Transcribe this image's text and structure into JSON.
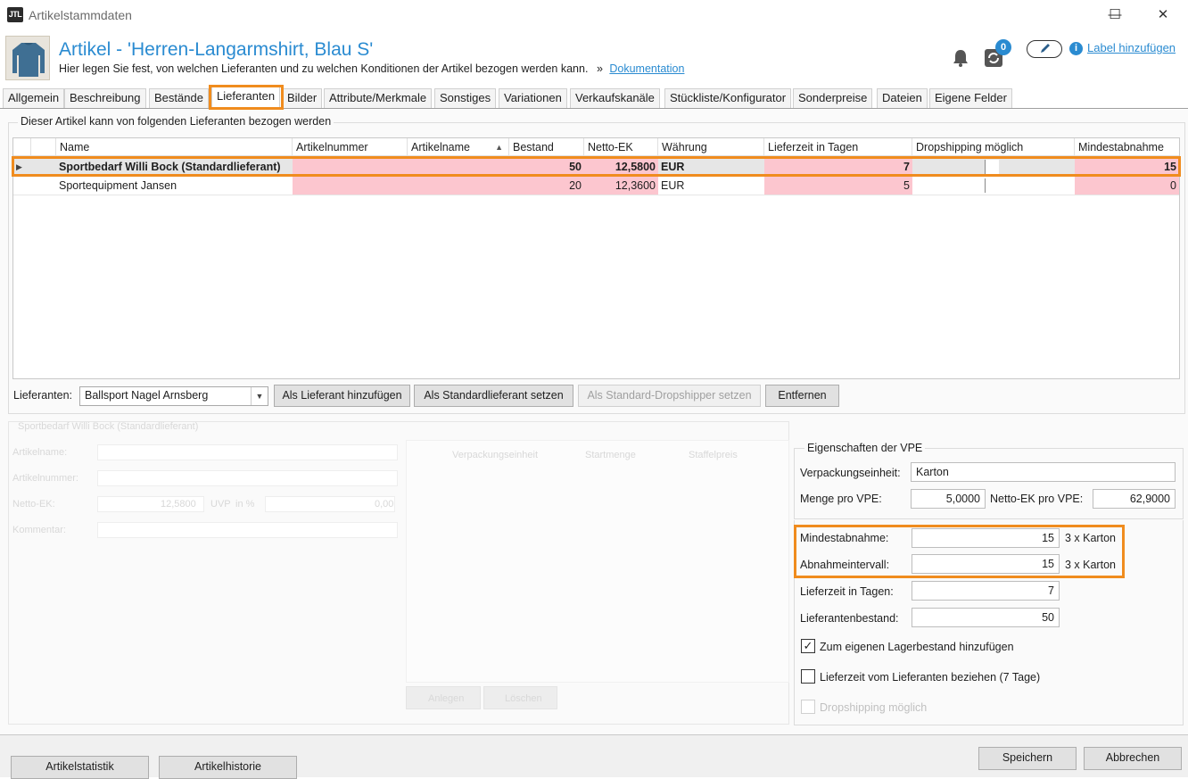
{
  "window": {
    "title": "Artikelstammdaten",
    "minimize": "—",
    "maximize": "☐",
    "close": "✕",
    "logo": "JTL"
  },
  "header": {
    "title": "Artikel - 'Herren-Langarmshirt, Blau S'",
    "description": "Hier legen Sie fest, von welchen Lieferanten und zu welchen Konditionen der Artikel bezogen werden kann.",
    "sep": "»",
    "doc_link": "Dokumentation",
    "sync_count": "0",
    "label_link": "Label hinzufügen"
  },
  "tabs": [
    {
      "label": "Allgemein"
    },
    {
      "label": "Beschreibung"
    },
    {
      "label": "Bestände"
    },
    {
      "label": "Lieferanten"
    },
    {
      "label": "Bilder"
    },
    {
      "label": "Attribute/Merkmale"
    },
    {
      "label": "Sonstiges"
    },
    {
      "label": "Variationen"
    },
    {
      "label": "Verkaufskanäle"
    },
    {
      "label": "Stückliste/Konfigurator"
    },
    {
      "label": "Sonderpreise"
    },
    {
      "label": "Dateien"
    },
    {
      "label": "Eigene Felder"
    }
  ],
  "suppliers_group": {
    "title": "Dieser Artikel kann von folgenden Lieferanten bezogen werden",
    "columns": [
      "Name",
      "Artikelnummer",
      "Artikelname",
      "Bestand",
      "Netto-EK",
      "Währung",
      "Lieferzeit in Tagen",
      "Dropshipping möglich",
      "Mindestabnahme"
    ],
    "rows": [
      {
        "name": "Sportbedarf Willi Bock (Standardlieferant)",
        "artnr": "",
        "artname": "",
        "bestand": "50",
        "netto": "12,5800",
        "waehrung": "EUR",
        "lieferzeit": "7",
        "mindest": "15"
      },
      {
        "name": "Sportequipment Jansen",
        "artnr": "",
        "artname": "",
        "bestand": "20",
        "netto": "12,3600",
        "waehrung": "EUR",
        "lieferzeit": "5",
        "mindest": "0"
      }
    ],
    "supplier_label": "Lieferanten:",
    "supplier_selected": "Ballsport Nagel Arnsberg",
    "btn_add": "Als Lieferant hinzufügen",
    "btn_standard": "Als Standardlieferant setzen",
    "btn_dropshipper": "Als Standard-Dropshipper setzen",
    "btn_remove": "Entfernen"
  },
  "detail_ghost": {
    "title": "Sportbedarf Willi Bock (Standardlieferant)",
    "labels": [
      "Artikelname:",
      "Artikelnummer:",
      "Netto-EK:",
      "Kommentar:"
    ],
    "netto_value": "12,5800",
    "uvp_label": "UVP",
    "uvp_pct": "in %",
    "uvp_value": "0,00",
    "grid_cols": [
      "Verpackungseinheit",
      "Startmenge",
      "Staffelpreis"
    ],
    "btn_add": "Anlegen",
    "btn_del": "Löschen"
  },
  "vpe": {
    "title": "Eigenschaften der VPE",
    "unit_label": "Verpackungseinheit:",
    "unit_value": "Karton",
    "qty_label": "Menge pro VPE:",
    "qty_value": "5,0000",
    "netto_label": "Netto-EK pro VPE:",
    "netto_value": "62,9000",
    "min_label": "Mindestabnahme:",
    "min_value": "15",
    "min_unit": "3 x Karton",
    "interval_label": "Abnahmeintervall:",
    "interval_value": "15",
    "interval_unit": "3 x Karton",
    "leadtime_label": "Lieferzeit in Tagen:",
    "leadtime_value": "7",
    "stock_label": "Lieferantenbestand:",
    "stock_value": "50",
    "chk_own_stock": "Zum eigenen Lagerbestand hinzufügen",
    "chk_leadtime": "Lieferzeit vom Lieferanten beziehen  (7 Tage)",
    "chk_dropship": "Dropshipping möglich"
  },
  "bottom": {
    "btn_statistik": "Artikelstatistik",
    "btn_historie": "Artikelhistorie",
    "btn_save": "Speichern",
    "btn_cancel": "Abbrechen"
  }
}
